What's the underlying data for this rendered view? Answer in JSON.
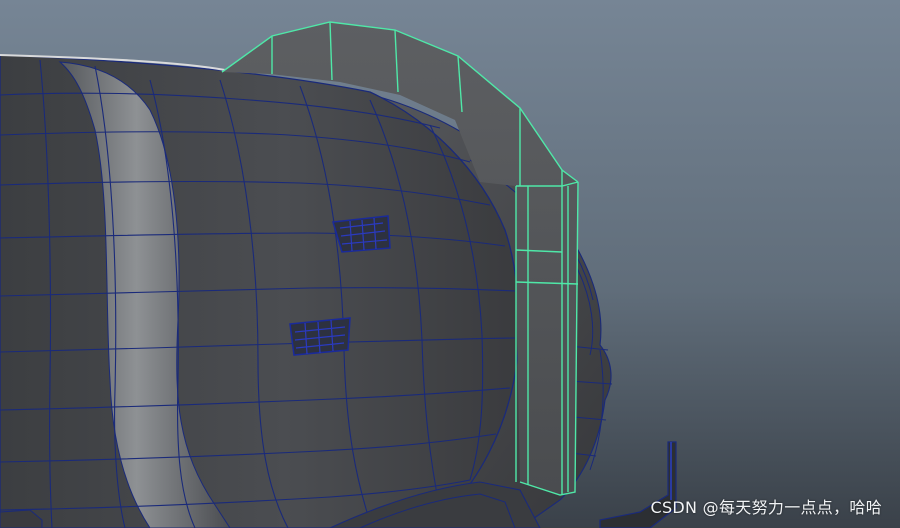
{
  "viewport": {
    "background_top": "#768595",
    "background_bottom": "#3a4149",
    "mesh_fill": "#4b4d50",
    "wire_color": "#1a2a7a",
    "selection_wire_color": "#4fe8a8"
  },
  "objects": {
    "tank_body": {
      "icon": "polygon-mesh-icon",
      "selected": false
    },
    "fender": {
      "icon": "polygon-mesh-icon",
      "selected": true
    },
    "small_panel_1": {
      "icon": "polygon-mesh-icon",
      "selected": false
    },
    "small_panel_2": {
      "icon": "polygon-mesh-icon",
      "selected": false
    },
    "rear_rail": {
      "icon": "polygon-mesh-icon",
      "selected": false
    }
  },
  "watermark": {
    "text": "CSDN @每天努力一点点，哈哈"
  }
}
